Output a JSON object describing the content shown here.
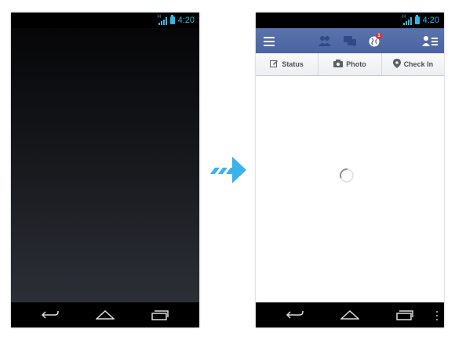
{
  "left_phone": {
    "status_bar": {
      "network": "H",
      "time": "4:20"
    }
  },
  "right_phone": {
    "status_bar": {
      "network": "H",
      "time": "4:20"
    },
    "header": {
      "icons": [
        "menu-icon",
        "friend-requests-icon",
        "messages-icon",
        "notifications-globe-icon",
        "contacts-list-icon"
      ],
      "notification_count": "1"
    },
    "actions": [
      {
        "label": "Status",
        "icon": "edit-icon"
      },
      {
        "label": "Photo",
        "icon": "camera-icon"
      },
      {
        "label": "Check In",
        "icon": "location-pin-icon"
      }
    ]
  },
  "nav_icons": [
    "back-icon",
    "home-icon",
    "recent-apps-icon"
  ],
  "colors": {
    "accent": "#33b5e5",
    "facebook_blue": "#4a64a2",
    "arrow": "#39b3e8",
    "badge": "#e0303c"
  }
}
